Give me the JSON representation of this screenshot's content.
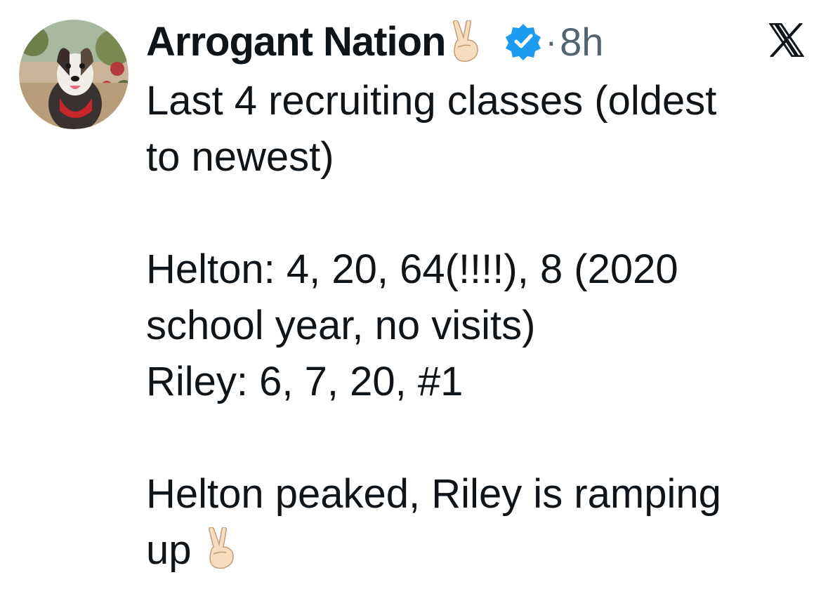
{
  "author": {
    "display_name": "Arrogant Nation",
    "name_emoji": "victory-hand-emoji",
    "verified_icon": "verified-badge-icon",
    "time": "8h",
    "separator": "·"
  },
  "brand": {
    "logo": "x-logo-icon"
  },
  "tweet": {
    "lines": [
      "Last 4 recruiting classes (oldest",
      "to newest)",
      "",
      "Helton: 4, 20, 64(!!!!), 8 (2020",
      "school year, no visits)",
      "Riley: 6, 7, 20, #1",
      "",
      "Helton peaked, Riley is ramping",
      "up"
    ],
    "trailing_emoji": "victory-hand-emoji"
  },
  "colors": {
    "text": "#0f1419",
    "muted": "#536471",
    "verified": "#1d9bf0"
  }
}
